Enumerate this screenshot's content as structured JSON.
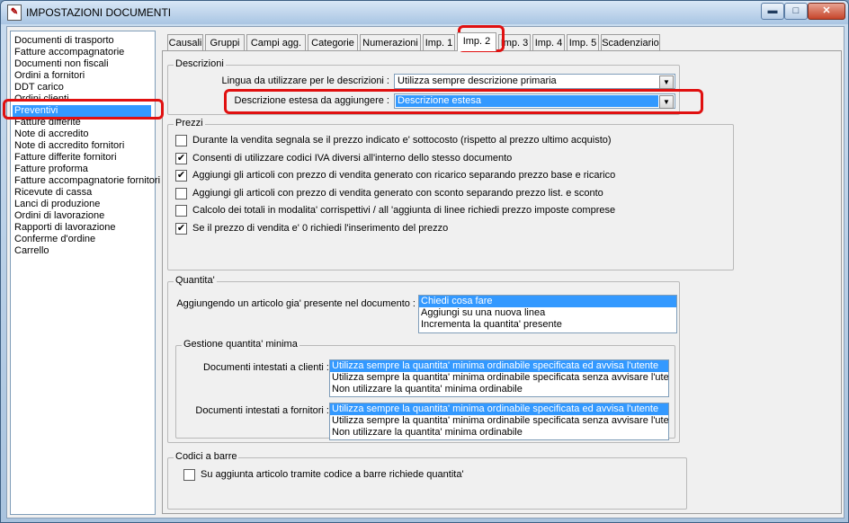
{
  "window": {
    "title": "IMPOSTAZIONI DOCUMENTI",
    "app_icon": "document-icon",
    "controls": {
      "minimize": "▬",
      "maximize": "□",
      "close": "✕"
    }
  },
  "doc_types": [
    "Documenti di trasporto",
    "Fatture accompagnatorie",
    "Documenti non fiscali",
    "Ordini a fornitori",
    "DDT carico",
    "Ordini clienti",
    "Preventivi",
    "Fatture differite",
    "Note di accredito",
    "Note di accredito fornitori",
    "Fatture differite fornitori",
    "Fatture proforma",
    "Fatture accompagnatorie fornitori",
    "Ricevute di cassa",
    "Lanci di produzione",
    "Ordini di lavorazione",
    "Rapporti di lavorazione",
    "Conferme d'ordine",
    "Carrello"
  ],
  "selected_doc_type": "Preventivi",
  "tabs": [
    "Causali",
    "Gruppi",
    "Campi agg.",
    "Categorie",
    "Numerazioni",
    "Imp. 1",
    "Imp. 2",
    "Imp. 3",
    "Imp. 4",
    "Imp. 5",
    "Scadenziario"
  ],
  "active_tab": "Imp. 2",
  "descrizioni": {
    "legend": "Descrizioni",
    "lingua_label": "Lingua da utilizzare per le descrizioni :",
    "lingua_value": "Utilizza sempre descrizione primaria",
    "estesa_label": "Descrizione estesa da aggiungere :",
    "estesa_value": "Descrizione estesa"
  },
  "prezzi": {
    "legend": "Prezzi",
    "options": [
      {
        "label": "Durante la vendita segnala se il prezzo indicato e' sottocosto (rispetto al prezzo ultimo acquisto)",
        "checked": false
      },
      {
        "label": "Consenti di utilizzare codici IVA diversi all'interno dello stesso documento",
        "checked": true
      },
      {
        "label": "Aggiungi gli articoli con prezzo di vendita generato con ricarico separando prezzo base e ricarico",
        "checked": true
      },
      {
        "label": "Aggiungi gli articoli con prezzo di vendita generato con sconto separando prezzo list. e sconto",
        "checked": false
      },
      {
        "label": "Calcolo dei totali in modalita' corrispettivi / all 'aggiunta di linee richiedi prezzo imposte comprese",
        "checked": false
      },
      {
        "label": "Se il prezzo di vendita e' 0 richiedi l'inserimento del prezzo",
        "checked": true
      }
    ]
  },
  "quantita": {
    "legend": "Quantita'",
    "presente_label": "Aggiungendo un articolo gia' presente nel documento :",
    "presente_options": [
      "Chiedi cosa fare",
      "Aggiungi su una nuova linea",
      "Incrementa la quantita' presente"
    ],
    "presente_selected": 0,
    "minima": {
      "legend": "Gestione quantita' minima",
      "clienti_label": "Documenti intestati a clienti :",
      "fornitori_label": "Documenti intestati a fornitori :",
      "options": [
        "Utilizza sempre la quantita' minima ordinabile specificata ed avvisa l'utente",
        "Utilizza sempre la quantita' minima ordinabile specificata senza avvisare l'utente",
        "Non utilizzare la quantita' minima ordinabile"
      ],
      "clienti_selected": 0,
      "fornitori_selected": 0
    }
  },
  "codici_barre": {
    "legend": "Codici a barre",
    "option": {
      "label": "Su aggiunta articolo tramite codice a barre richiede quantita'",
      "checked": false
    }
  },
  "colors": {
    "selection": "#3399ff",
    "highlight_box": "#e01010"
  }
}
